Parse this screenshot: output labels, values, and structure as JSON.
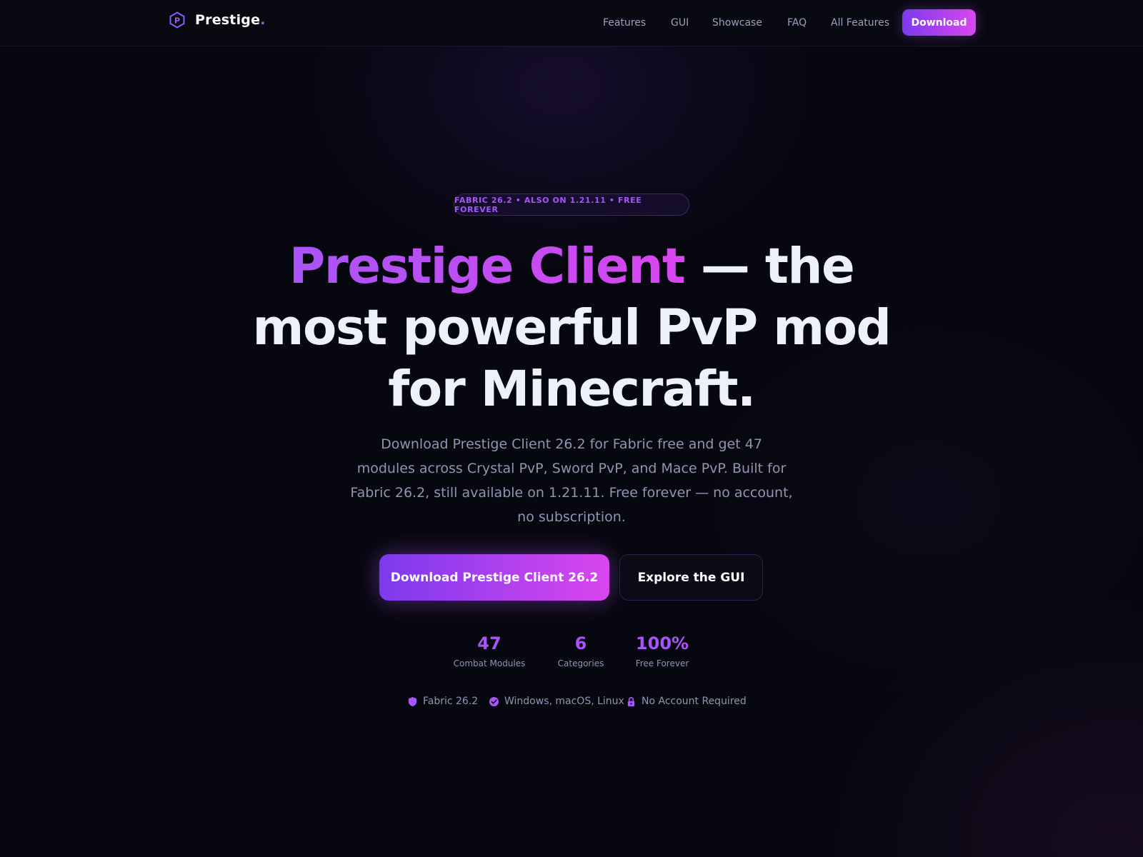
{
  "nav": {
    "brand": "Prestige",
    "brand_dot": ".",
    "links": [
      "Features",
      "GUI",
      "Showcase",
      "FAQ",
      "All Features"
    ],
    "cta": "Download"
  },
  "hero": {
    "badge": "FABRIC 26.2 • ALSO ON 1.21.11 • FREE FOREVER",
    "headline_accent": "Prestige Client",
    "headline_rest_1": " — the",
    "headline_line_2": "most powerful PvP mod",
    "headline_line_3": "for Minecraft.",
    "subtitle": "Download Prestige Client 26.2 for Fabric free and get 47 modules across Crystal PvP, Sword PvP, and Mace PvP. Built for Fabric 26.2, still available on 1.21.11. Free forever — no account, no subscription.",
    "primary_button": "Download Prestige Client 26.2",
    "secondary_button": "Explore the GUI"
  },
  "stats": [
    {
      "value": "47",
      "label": "Combat Modules"
    },
    {
      "value": "6",
      "label": "Categories"
    },
    {
      "value": "100%",
      "label": "Free Forever"
    }
  ],
  "features": [
    {
      "icon": "shield-icon",
      "label": "Fabric 26.2"
    },
    {
      "icon": "check-circle-icon",
      "label": "Windows, macOS, Linux"
    },
    {
      "icon": "lock-icon",
      "label": "No Account Required"
    }
  ],
  "colors": {
    "accent": "#a855f7",
    "accent_pink": "#d946ef",
    "background": "#07070f",
    "muted_text": "#8f95b3"
  }
}
